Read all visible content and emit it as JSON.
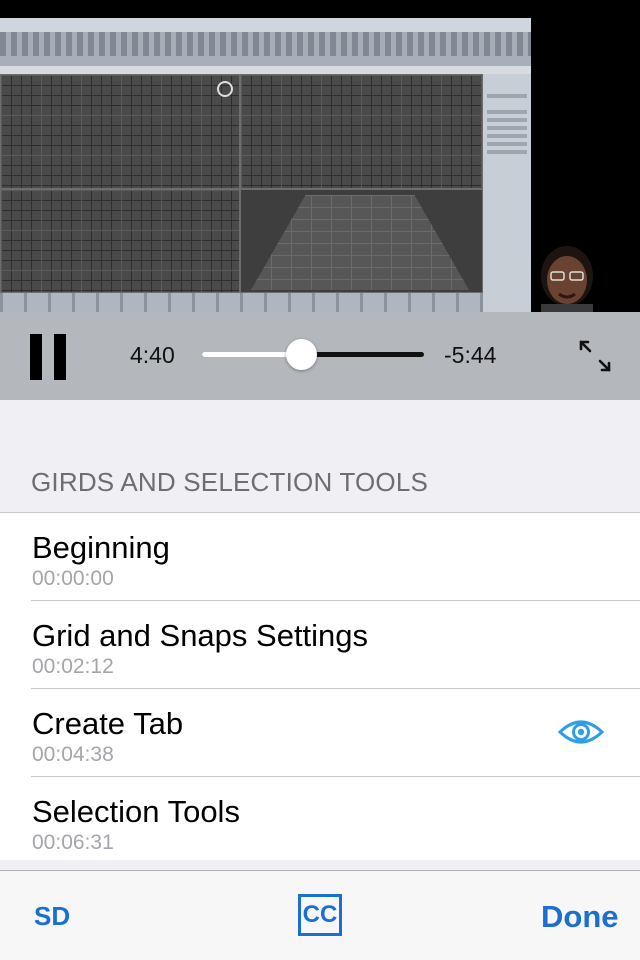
{
  "player": {
    "elapsed": "4:40",
    "remaining": "-5:44",
    "progress_fraction": 0.45
  },
  "chapters": {
    "section_title": "GIRDS AND SELECTION TOOLS",
    "items": [
      {
        "title": "Beginning",
        "timestamp": "00:00:00",
        "current": false
      },
      {
        "title": "Grid and Snaps Settings",
        "timestamp": "00:02:12",
        "current": false
      },
      {
        "title": "Create Tab",
        "timestamp": "00:04:38",
        "current": true
      },
      {
        "title": "Selection Tools",
        "timestamp": "00:06:31",
        "current": false
      }
    ]
  },
  "toolbar": {
    "sd_label": "SD",
    "cc_label": "CC",
    "done_label": "Done"
  },
  "colors": {
    "accent": "#1a6fd1",
    "eye": "#2f9ee5"
  }
}
